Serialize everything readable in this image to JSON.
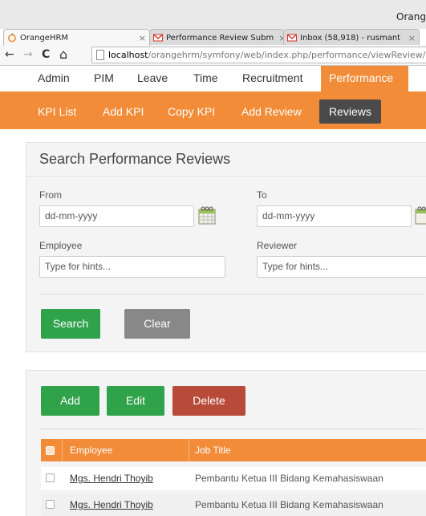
{
  "window": {
    "title": "Orang"
  },
  "tabs": [
    {
      "label": "OrangeHRM",
      "close": "×",
      "active": true
    },
    {
      "label": "Performance Review Subm",
      "close": "×",
      "active": false
    },
    {
      "label": "Inbox (58,918) - rusmant",
      "close": "×",
      "active": false
    }
  ],
  "toolbar": {
    "back": "←",
    "forward": "→",
    "reload": "C",
    "home": "⌂",
    "url_host": "localhost",
    "url_path": "/orangehrm/symfony/web/index.php/performance/viewReview/m"
  },
  "main_menu": [
    {
      "label": "Admin"
    },
    {
      "label": "PIM"
    },
    {
      "label": "Leave"
    },
    {
      "label": "Time"
    },
    {
      "label": "Recruitment"
    },
    {
      "label": "Performance",
      "active": true
    }
  ],
  "sub_menu": [
    {
      "label": "KPI List"
    },
    {
      "label": "Add KPI"
    },
    {
      "label": "Copy KPI"
    },
    {
      "label": "Add Review"
    },
    {
      "label": "Reviews",
      "active": true
    }
  ],
  "search": {
    "title": "Search Performance Reviews",
    "from_label": "From",
    "from_placeholder": "dd-mm-yyyy",
    "to_label": "To",
    "to_placeholder": "dd-mm-yyyy",
    "employee_label": "Employee",
    "employee_placeholder": "Type for hints...",
    "reviewer_label": "Reviewer",
    "reviewer_placeholder": "Type for hints...",
    "search_button": "Search",
    "clear_button": "Clear"
  },
  "results": {
    "add_button": "Add",
    "edit_button": "Edit",
    "delete_button": "Delete",
    "columns": [
      "Employee",
      "Job Title"
    ],
    "rows": [
      {
        "employee": "Mgs. Hendri Thoyib",
        "job_title": "Pembantu Ketua III Bidang Kemahasiswaan"
      },
      {
        "employee": "Mgs. Hendri Thoyib",
        "job_title": "Pembantu Ketua III Bidang Kemahasiswaan"
      }
    ]
  },
  "colors": {
    "accent": "#f28c38",
    "active_submenu": "#4a4a4a",
    "green_button": "#2fa24a",
    "gray_button": "#888888",
    "red_button": "#b84a3a"
  },
  "icons": {
    "favicon_orangehrm": "orangehrm-logo-icon",
    "favicon_gmail": "gmail-icon",
    "calendar": "calendar-icon",
    "page": "page-icon"
  }
}
